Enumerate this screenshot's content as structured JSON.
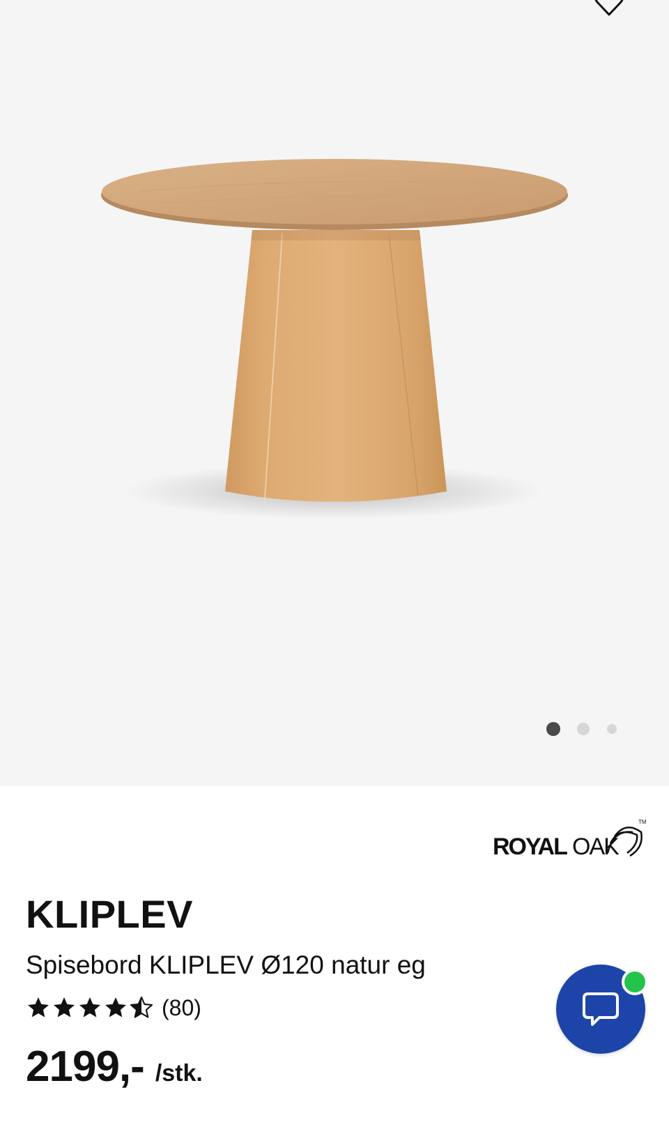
{
  "product": {
    "brand": "ROYAL OAK",
    "brand_part_1": "ROYAL",
    "brand_part_2": "OAK",
    "name": "KLIPLEV",
    "description": "Spisebord KLIPLEV Ø120 natur eg",
    "rating": 4.5,
    "rating_count": "(80)",
    "price": "2199,-",
    "unit": "/stk."
  },
  "gallery": {
    "image_count": 3,
    "active_index": 0
  },
  "icons": {
    "favorite": "heart-outline-icon",
    "chat": "speech-bubble-icon",
    "star_full": "star-full-icon",
    "star_half": "star-half-icon"
  },
  "colors": {
    "gallery_bg": "#f5f5f5",
    "chat_button": "#1d44a8",
    "online_indicator": "#23c44a",
    "active_dot": "#4a4a4a",
    "inactive_dot": "#d6d6d6"
  }
}
